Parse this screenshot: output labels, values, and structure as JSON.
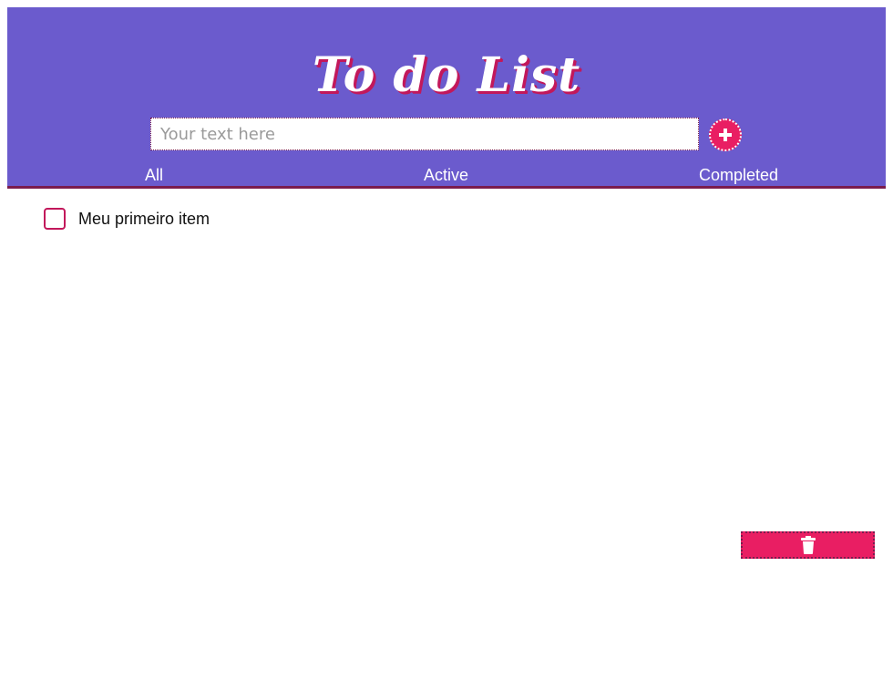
{
  "header": {
    "title": "To do List",
    "input_placeholder": "Your text here",
    "input_value": "",
    "add_button_icon": "plus-icon"
  },
  "tabs": [
    {
      "label": "All"
    },
    {
      "label": "Active"
    },
    {
      "label": "Completed"
    }
  ],
  "list": {
    "items": [
      {
        "label": "Meu primeiro item",
        "checked": false
      }
    ]
  },
  "footer": {
    "delete_button_icon": "trash-icon"
  },
  "colors": {
    "header_background": "#6b5bcd",
    "accent": "#e91e63",
    "border_accent": "#7a1c4e",
    "checkbox_border": "#c2185b"
  }
}
